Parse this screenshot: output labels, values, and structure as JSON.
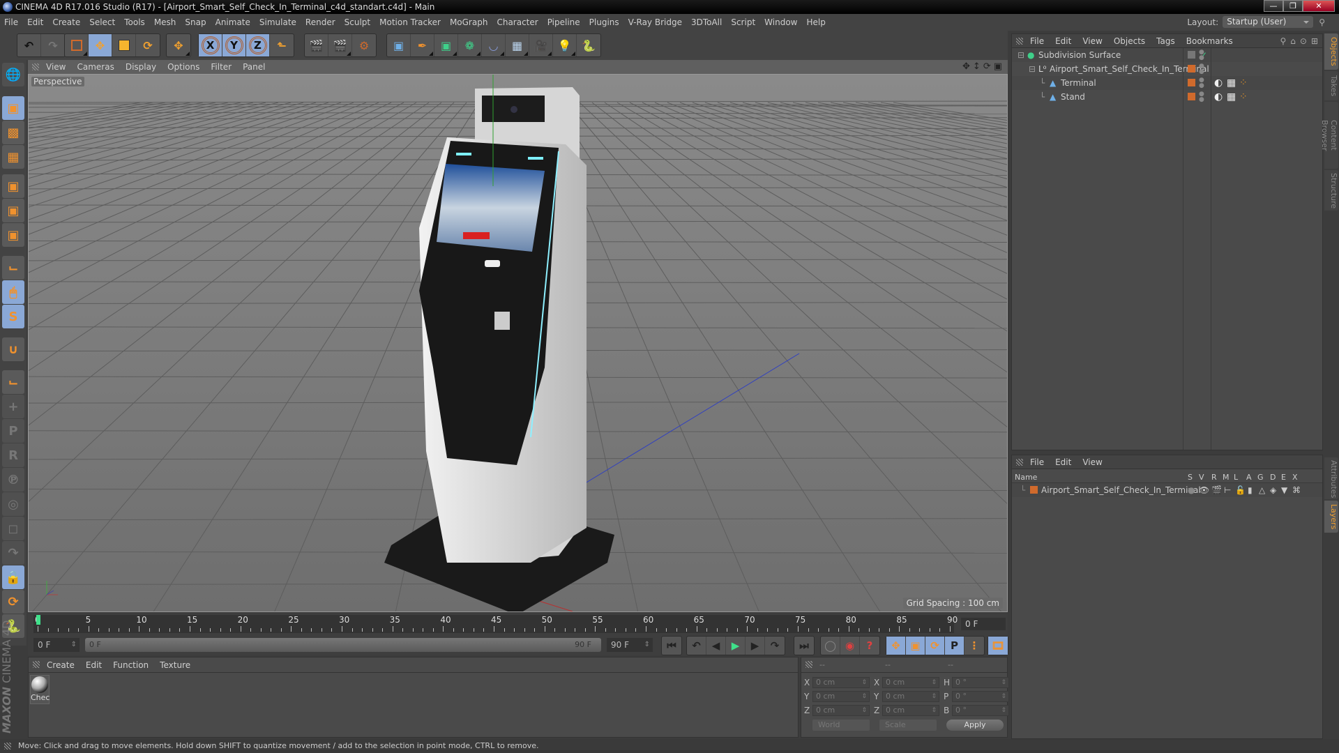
{
  "window": {
    "title": "CINEMA 4D R17.016 Studio (R17) - [Airport_Smart_Self_Check_In_Terminal_c4d_standart.c4d] - Main",
    "controls": [
      "minimize",
      "restore",
      "close"
    ]
  },
  "menubar": {
    "items": [
      "File",
      "Edit",
      "Create",
      "Select",
      "Tools",
      "Mesh",
      "Snap",
      "Animate",
      "Simulate",
      "Render",
      "Sculpt",
      "Motion Tracker",
      "MoGraph",
      "Character",
      "Pipeline",
      "Plugins",
      "V-Ray Bridge",
      "3DToAll",
      "Script",
      "Window",
      "Help"
    ],
    "layout_label": "Layout:",
    "layout_value": "Startup (User)"
  },
  "toolbar": {
    "groups": [
      [
        "undo-icon",
        "redo-icon"
      ],
      [
        "live-selection-icon",
        "move-icon",
        "scale-icon",
        "rotate-icon"
      ],
      [
        "move-last-icon"
      ],
      [
        "x-axis-icon",
        "y-axis-icon",
        "z-axis-icon",
        "coordinate-system-icon"
      ],
      [
        "render-view-icon",
        "render-picture-viewer-icon",
        "render-settings-icon"
      ],
      [
        "cube-icon",
        "pen-icon",
        "subdivision-icon",
        "cloner-icon",
        "deformer-icon",
        "floor-icon",
        "camera-icon",
        "light-icon",
        "python-icon"
      ]
    ],
    "axis_labels": [
      "X",
      "Y",
      "Z"
    ]
  },
  "left_toolbar": {
    "items": [
      "make-editable-icon",
      "model-mode-icon",
      "texture-mode-icon",
      "workplane-mode-icon",
      "points-mode-icon",
      "edges-mode-icon",
      "polygons-mode-icon",
      "axis-mode-icon",
      "tweak-mode-icon",
      "snap-icon",
      "magnet-icon",
      "workplane-axis-icon",
      "add-point-icon",
      "pin-p-icon",
      "pin-r-icon",
      "pin-psr-icon",
      "pin-target-icon",
      "pin-scale-icon",
      "pin-bend-icon",
      "lock-workplane-icon",
      "workplane-align-icon",
      "python-script-icon"
    ]
  },
  "viewport": {
    "menu": [
      "View",
      "Cameras",
      "Display",
      "Options",
      "Filter",
      "Panel"
    ],
    "label": "Perspective",
    "grid_spacing": "Grid Spacing : 100 cm",
    "nav_icons": [
      "move-view-icon",
      "zoom-view-icon",
      "rotate-view-icon",
      "maximize-view-icon"
    ]
  },
  "timeline": {
    "ticks": [
      0,
      5,
      10,
      15,
      20,
      25,
      30,
      35,
      40,
      45,
      50,
      55,
      60,
      65,
      70,
      75,
      80,
      85,
      90
    ],
    "current_frame": "0 F",
    "start_field": "0 F",
    "range_start": "0 F",
    "range_end": "90 F",
    "end_field": "90 F",
    "max_frame": 90
  },
  "transport": {
    "buttons": [
      "go-to-start-icon",
      "previous-key-icon",
      "previous-frame-icon",
      "play-icon",
      "next-frame-icon",
      "next-key-icon",
      "go-to-end-icon"
    ],
    "record": [
      "motion-record-icon",
      "autokey-icon",
      "keyframe-selection-icon"
    ],
    "key_tracks": [
      "key-position-icon",
      "key-scale-icon",
      "key-rotation-icon",
      "key-param-icon",
      "key-pla-icon"
    ],
    "timeline_button": "timeline-icon"
  },
  "material_manager": {
    "menu": [
      "Create",
      "Edit",
      "Function",
      "Texture"
    ],
    "materials": [
      {
        "name": "Chec"
      }
    ],
    "brand_top": "MAXON",
    "brand_bottom": "CINEMA 4D"
  },
  "coordinates": {
    "headers": [
      "--",
      "--",
      "--"
    ],
    "rows": [
      {
        "a": "X",
        "av": "0 cm",
        "b": "X",
        "bv": "0 cm",
        "c": "H",
        "cv": "0 °"
      },
      {
        "a": "Y",
        "av": "0 cm",
        "b": "Y",
        "bv": "0 cm",
        "c": "P",
        "cv": "0 °"
      },
      {
        "a": "Z",
        "av": "0 cm",
        "b": "Z",
        "bv": "0 cm",
        "c": "B",
        "cv": "0 °"
      }
    ],
    "mode": "World",
    "type": "Scale",
    "apply_label": "Apply"
  },
  "object_manager": {
    "menu": [
      "File",
      "Edit",
      "View",
      "Objects",
      "Tags",
      "Bookmarks"
    ],
    "objects": [
      {
        "name": "Subdivision Surface",
        "indent": 0,
        "icon": "subdivision-surface-icon",
        "tags": []
      },
      {
        "name": "Airport_Smart_Self_Check_In_Terminal",
        "indent": 1,
        "icon": "null-object-icon",
        "tags": []
      },
      {
        "name": "Terminal",
        "indent": 2,
        "icon": "polygon-object-icon",
        "tags": [
          "material-tag-icon",
          "texture-tag-icon",
          "phong-tag-icon"
        ]
      },
      {
        "name": "Stand",
        "indent": 2,
        "icon": "polygon-object-icon",
        "tags": [
          "material-tag-icon",
          "texture-tag-icon",
          "phong-tag-icon"
        ]
      }
    ],
    "layer_color": "#d06a2c"
  },
  "layer_manager": {
    "menu": [
      "File",
      "Edit",
      "View"
    ],
    "columns": [
      "Name",
      "S",
      "V",
      "R",
      "M",
      "L",
      "A",
      "G",
      "D",
      "E",
      "X"
    ],
    "layers": [
      {
        "name": "Airport_Smart_Self_Check_In_Terminal",
        "color": "#d06a2c"
      }
    ]
  },
  "side_tabs": {
    "top": [
      {
        "label": "Objects",
        "active": true
      },
      {
        "label": "Takes",
        "active": false
      },
      {
        "label": "Content Browser",
        "active": false
      },
      {
        "label": "Structure",
        "active": false
      }
    ],
    "bottom": [
      {
        "label": "Attributes",
        "active": false
      },
      {
        "label": "Layers",
        "active": true
      }
    ]
  },
  "status": {
    "text": "Move: Click and drag to move elements. Hold down SHIFT to quantize movement / add to the selection in point mode, CTRL to remove."
  },
  "colors": {
    "accent": "#f0a030",
    "active_button": "#8aa8d6",
    "layer": "#d06a2c"
  }
}
